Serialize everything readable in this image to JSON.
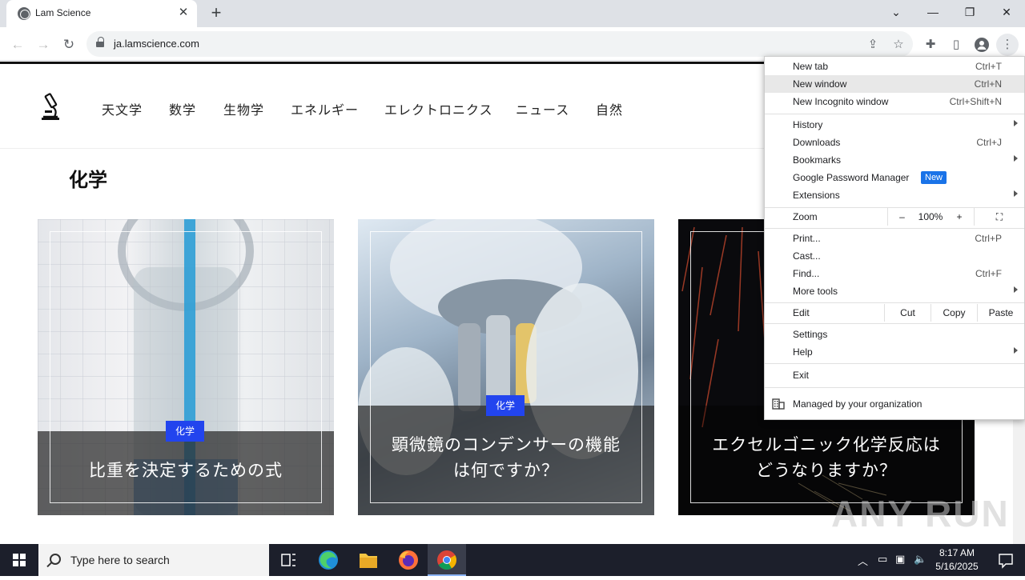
{
  "browser": {
    "tab_title": "Lam Science",
    "url": "ja.lamscience.com"
  },
  "site": {
    "nav": [
      "天文学",
      "数学",
      "生物学",
      "エネルギー",
      "エレクトロニクス",
      "ニュース",
      "自然"
    ],
    "page_title": "化学",
    "cards": [
      {
        "category": "化学",
        "title_line1": "比重を決定するための式",
        "title_line2": ""
      },
      {
        "category": "化学",
        "title_line1": "顕微鏡のコンデンサーの機能",
        "title_line2": "は何ですか？"
      },
      {
        "category": "",
        "title_line1": "エクセルゴニック化学反応は",
        "title_line2": "どうなりますか？"
      }
    ],
    "watermark": "ANY RUN"
  },
  "menu": {
    "new_tab": {
      "label": "New tab",
      "shortcut": "Ctrl+T"
    },
    "new_window": {
      "label": "New window",
      "shortcut": "Ctrl+N"
    },
    "new_incognito": {
      "label": "New Incognito window",
      "shortcut": "Ctrl+Shift+N"
    },
    "history": {
      "label": "History"
    },
    "downloads": {
      "label": "Downloads",
      "shortcut": "Ctrl+J"
    },
    "bookmarks": {
      "label": "Bookmarks"
    },
    "password_manager": {
      "label": "Google Password Manager",
      "badge": "New"
    },
    "extensions": {
      "label": "Extensions"
    },
    "zoom": {
      "label": "Zoom",
      "minus": "–",
      "level": "100%",
      "plus": "+"
    },
    "print": {
      "label": "Print...",
      "shortcut": "Ctrl+P"
    },
    "cast": {
      "label": "Cast..."
    },
    "find": {
      "label": "Find...",
      "shortcut": "Ctrl+F"
    },
    "more_tools": {
      "label": "More tools"
    },
    "edit": {
      "label": "Edit",
      "cut": "Cut",
      "copy": "Copy",
      "paste": "Paste"
    },
    "settings": {
      "label": "Settings"
    },
    "help": {
      "label": "Help"
    },
    "exit": {
      "label": "Exit"
    },
    "managed": {
      "label": "Managed by your organization"
    }
  },
  "taskbar": {
    "search_placeholder": "Type here to search",
    "time": "8:17 AM",
    "date": "5/16/2025"
  },
  "colors": {
    "accent_badge": "#2244ee",
    "menu_new_badge": "#1a73e8",
    "taskbar": "#1c1f2b"
  }
}
